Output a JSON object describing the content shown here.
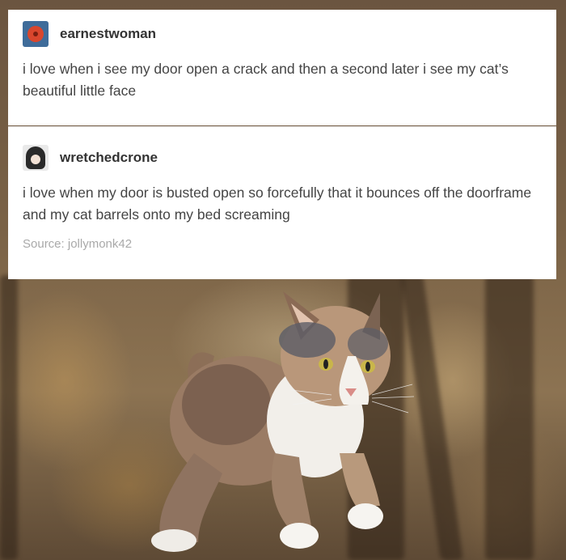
{
  "posts": [
    {
      "username": "earnestwoman",
      "text": "i love when i see my door open a crack and then a second later i see my cat’s beautiful little face"
    },
    {
      "username": "wretchedcrone",
      "text": "i love when my door is busted open so forcefully that it bounces off the doorframe and my cat barrels onto my bed screaming"
    }
  ],
  "source": "Source: jollymonk42"
}
